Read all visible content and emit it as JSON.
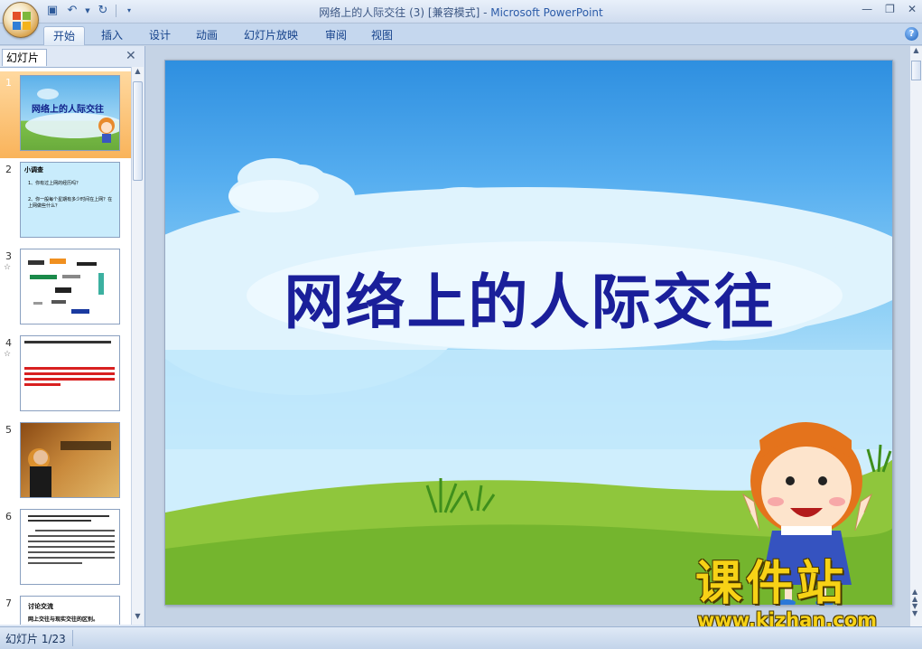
{
  "window": {
    "title": "网络上的人际交往 (3) [兼容模式] - ",
    "app_name": "Microsoft PowerPoint"
  },
  "qat": {
    "save_icon": "save-icon",
    "undo_icon": "undo-icon",
    "redo_icon": "redo-icon"
  },
  "ribbon": {
    "tabs": [
      "开始",
      "插入",
      "设计",
      "动画",
      "幻灯片放映",
      "审阅",
      "视图"
    ],
    "active_tab": "开始"
  },
  "slides_pane": {
    "tab_label": "幻灯片",
    "thumbnails": [
      {
        "num": "1",
        "text": "网络上的人际交往",
        "selected": true
      },
      {
        "num": "2",
        "heading": "小调查",
        "lines": [
          "1、你有过上网的经历吗？",
          "2、你一般每个星期有多少时间在上网？在上网做些什么？"
        ]
      },
      {
        "num": "3",
        "anim": true
      },
      {
        "num": "4",
        "anim": true
      },
      {
        "num": "5"
      },
      {
        "num": "6"
      },
      {
        "num": "7",
        "heading": "讨论交流",
        "lines": [
          "网上交往与现实交往的区别。"
        ]
      }
    ]
  },
  "slide": {
    "title": "网络上的人际交往"
  },
  "watermark": {
    "brand": "课件站",
    "url": "www.kjzhan.com"
  },
  "status": {
    "slide_indicator": "幻灯片 1/23"
  },
  "colors": {
    "title_text": "#1a1f9a",
    "selected_thumb": "#f9b35a",
    "watermark": "#f7d216"
  }
}
